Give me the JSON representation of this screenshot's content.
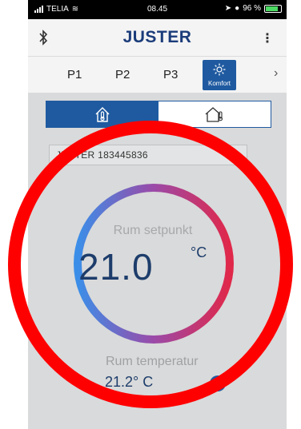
{
  "status_bar": {
    "carrier": "TELIA",
    "time": "08.45",
    "battery": "96 %"
  },
  "header": {
    "title": "JUSTER",
    "menu_icon": "more-vertical-icon",
    "bluetooth_icon": "bluetooth-icon"
  },
  "tabs": [
    {
      "label": "P1"
    },
    {
      "label": "P2"
    },
    {
      "label": "P3"
    },
    {
      "label": "Komfort",
      "icon": "sun-icon",
      "active": true
    }
  ],
  "mode": {
    "left": "house-thermometer-icon",
    "right": "house-thermometer-outline-icon"
  },
  "device": {
    "name": "JUSTER 183445836"
  },
  "setpoint": {
    "label": "Rum setpunkt",
    "value": "21.0",
    "unit": "°C"
  },
  "room": {
    "label": "Rum temperatur",
    "value": "21.2° C"
  },
  "colors": {
    "accent": "#1f5aa0",
    "ring_cold": "#3b8ee8",
    "ring_hot": "#e0284a",
    "annotation": "#ff0000"
  }
}
